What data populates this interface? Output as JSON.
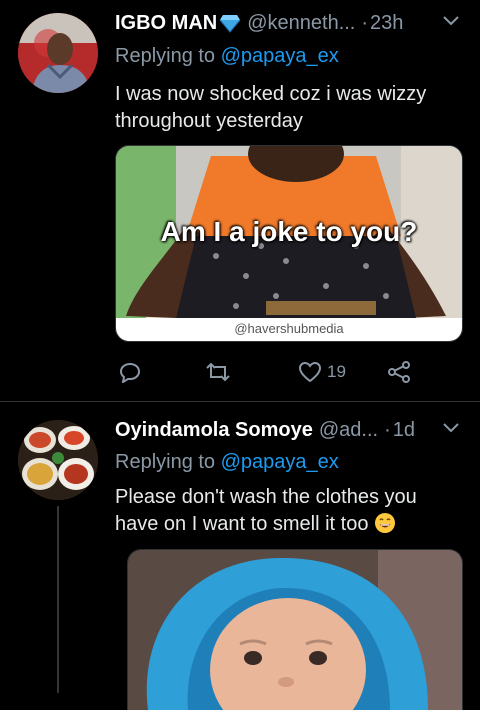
{
  "colors": {
    "background": "#000000",
    "text": "#e7e9ea",
    "secondary": "#8b98a5",
    "mention": "#1d9bf0",
    "divider": "#2f3336"
  },
  "tweets": [
    {
      "display_name": "IGBO MAN",
      "badge_icon": "gem-icon",
      "handle": "@kenneth...",
      "dot": "·",
      "time": "23h",
      "replying_prefix": "Replying to",
      "replying_to": "@papaya_ex",
      "text": "I was now shocked coz i was wizzy throughout yesterday",
      "meme_caption": "Am I a joke to you?",
      "meme_watermark": "@havershubmedia",
      "like_count": "19"
    },
    {
      "display_name": "Oyindamola Somoye",
      "handle": "@ad...",
      "dot": "·",
      "time": "1d",
      "replying_prefix": "Replying to",
      "replying_to": "@papaya_ex",
      "text": "Please don't wash the clothes you have on I want to smell it too",
      "emoji_icon": "grinning-face-icon"
    }
  ]
}
